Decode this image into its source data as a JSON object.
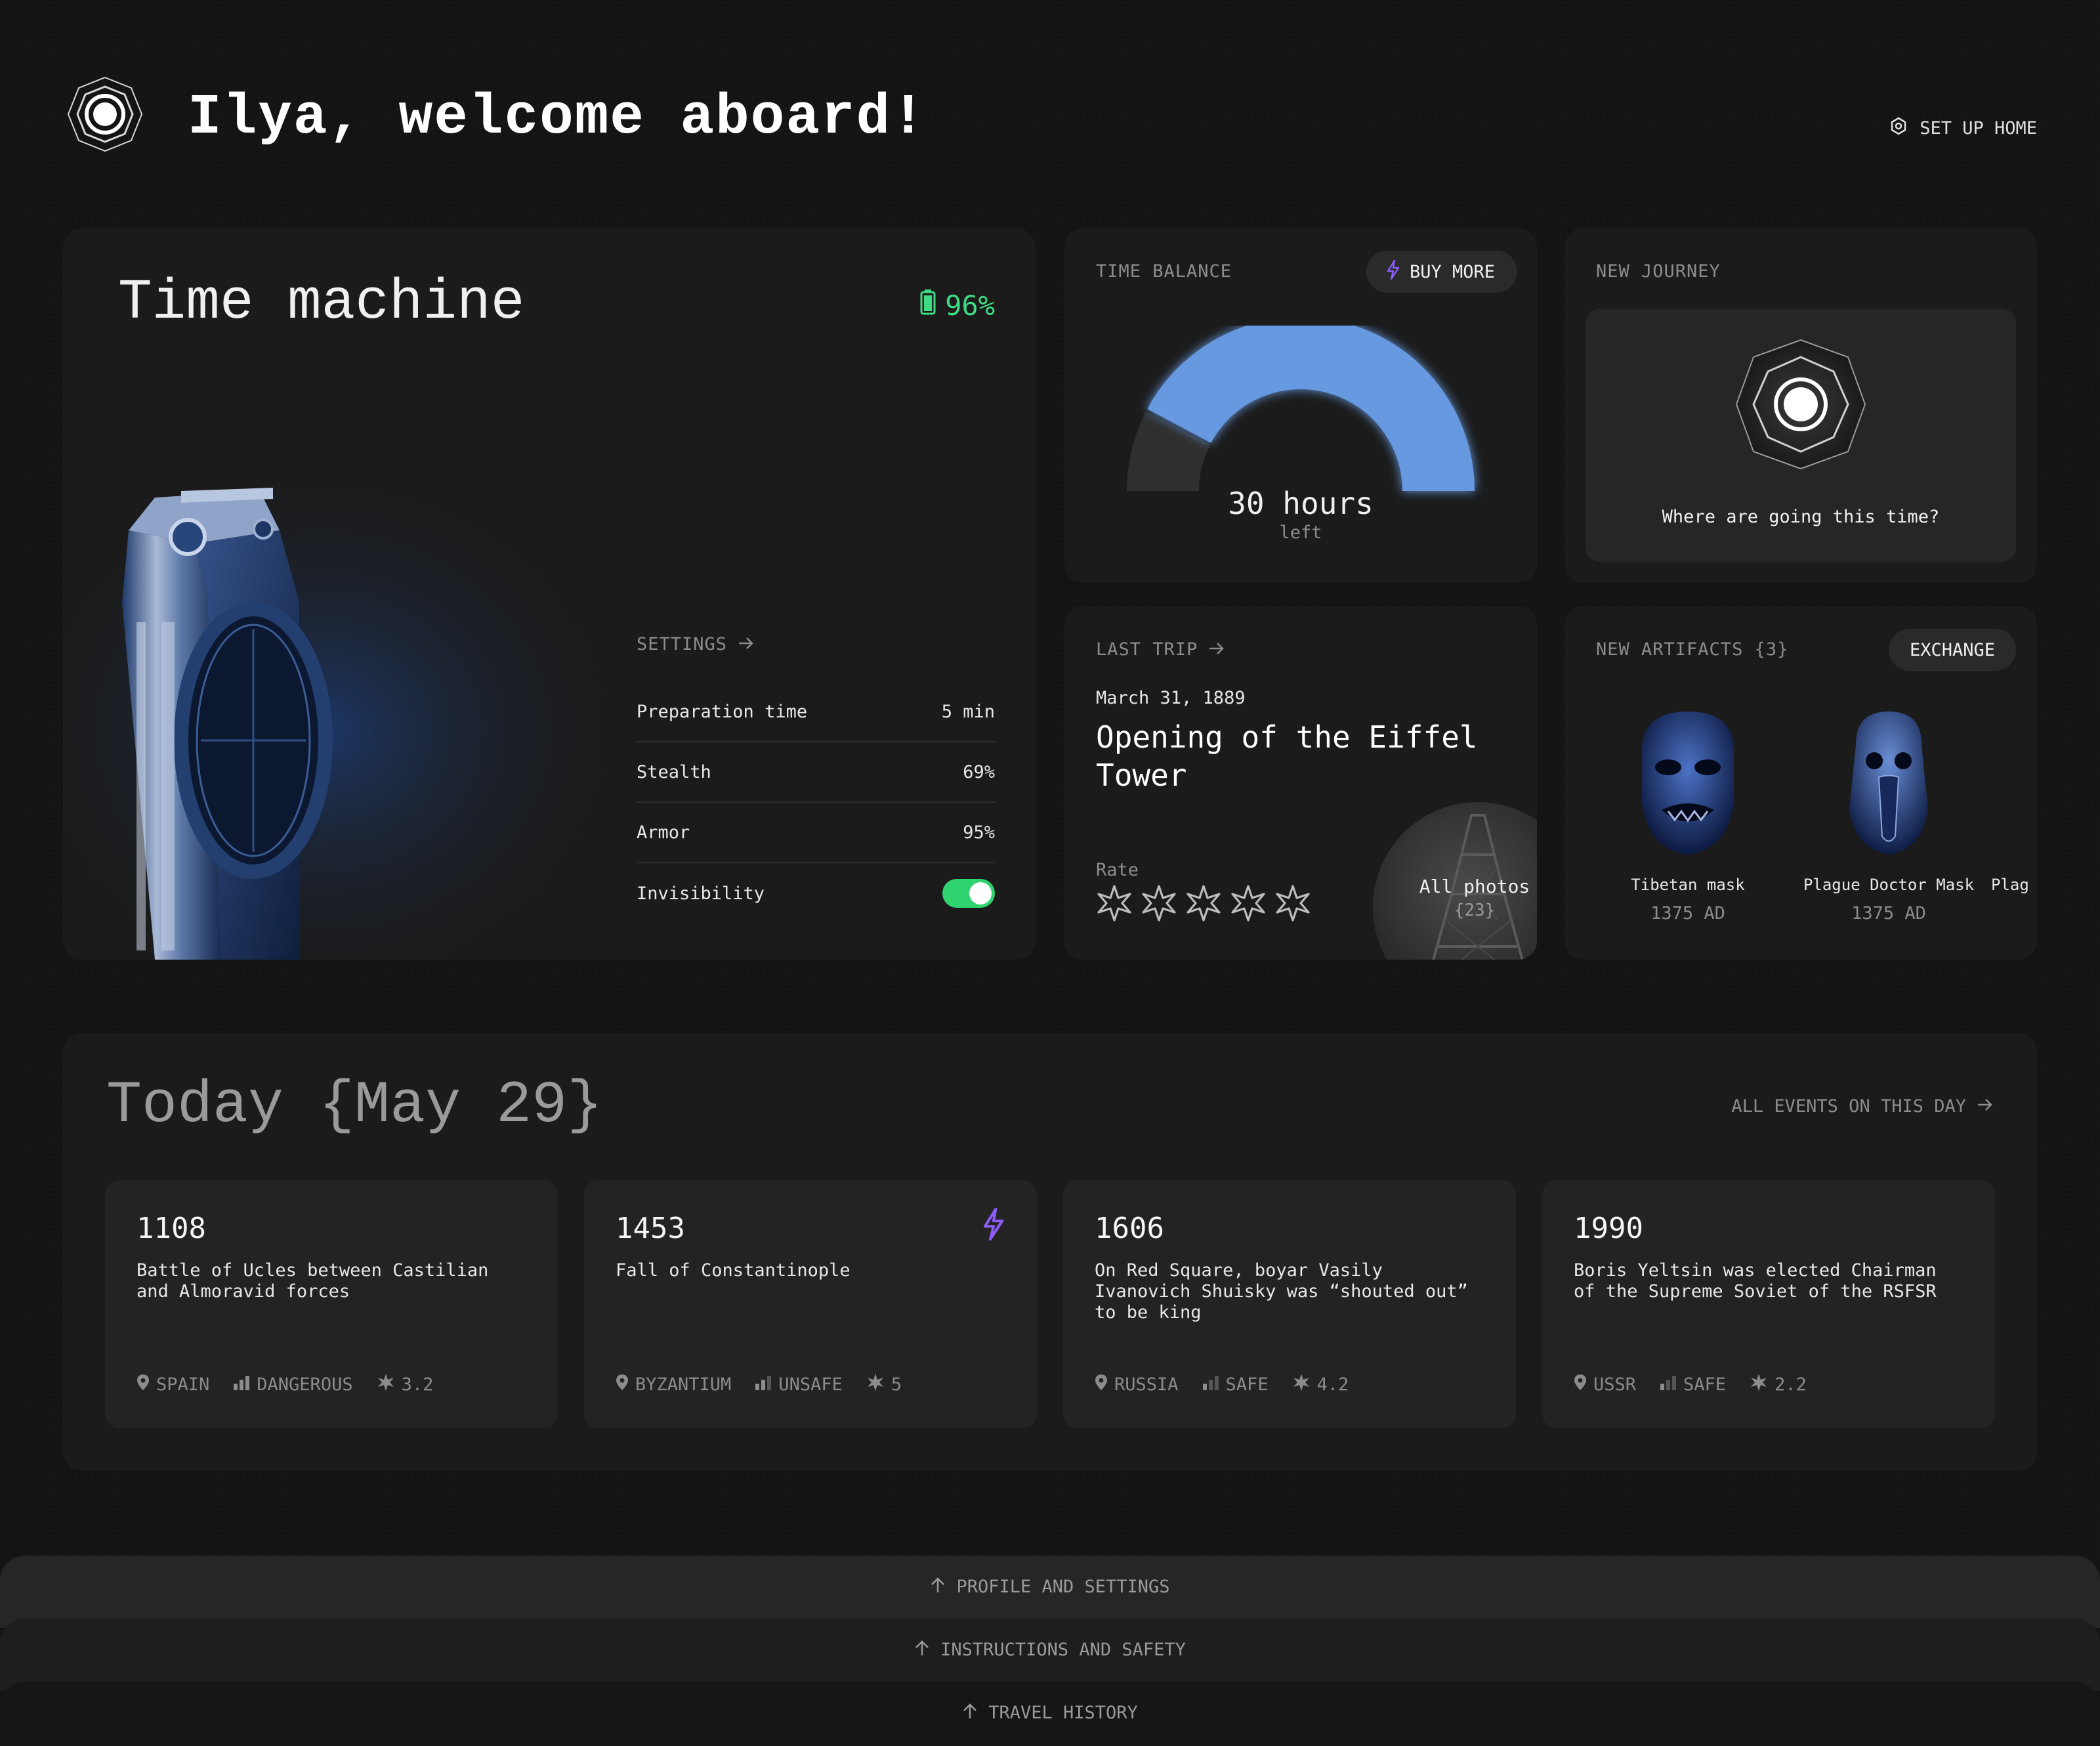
{
  "header": {
    "welcome": "Ilya, welcome aboard!",
    "setup_home": "SET UP HOME"
  },
  "time_machine": {
    "title": "Time machine",
    "battery": "96%",
    "settings_label": "SETTINGS",
    "settings": [
      {
        "label": "Preparation time",
        "value": "5 min"
      },
      {
        "label": "Stealth",
        "value": "69%"
      },
      {
        "label": "Armor",
        "value": "95%"
      },
      {
        "label": "Invisibility",
        "value": ""
      }
    ],
    "invisibility_on": true
  },
  "time_balance": {
    "label": "TIME BALANCE",
    "buy_more": "BUY MORE",
    "hours": "30 hours",
    "left": "left",
    "fill_fraction": 0.85,
    "accent": "#6699e0"
  },
  "new_journey": {
    "label": "NEW JOURNEY",
    "prompt": "Where are going this time?"
  },
  "last_trip": {
    "label": "LAST TRIP",
    "date": "March 31, 1889",
    "title": "Opening of the Eiffel Tower",
    "rate_label": "Rate",
    "rating": 0,
    "all_photos": "All photos",
    "photo_count": "{23}"
  },
  "artifacts": {
    "label": "NEW ARTIFACTS {3}",
    "exchange": "EXCHANGE",
    "items": [
      {
        "name": "Tibetan mask",
        "year": "1375 AD"
      },
      {
        "name": "Plague Doctor Mask",
        "year": "1375 AD"
      },
      {
        "name": "Plag",
        "year": ""
      }
    ]
  },
  "today": {
    "title": "Today {May 29}",
    "all_events": "ALL EVENTS ON THIS DAY",
    "events": [
      {
        "year": "1108",
        "desc": "Battle of Ucles between Castilian and Almoravid forces",
        "place": "SPAIN",
        "danger": "DANGEROUS",
        "rating": "3.2"
      },
      {
        "year": "1453",
        "desc": "Fall of Constantinople",
        "place": "BYZANTIUM",
        "danger": "UNSAFE",
        "rating": "5"
      },
      {
        "year": "1606",
        "desc": "On Red Square, boyar Vasily Ivanovich Shuisky was “shouted out” to be king",
        "place": "RUSSIA",
        "danger": "SAFE",
        "rating": "4.2"
      },
      {
        "year": "1990",
        "desc": "Boris Yeltsin was elected Chairman of the Supreme Soviet of the RSFSR",
        "place": "USSR",
        "danger": "SAFE",
        "rating": "2.2"
      }
    ]
  },
  "drawers": {
    "profile": "PROFILE AND SETTINGS",
    "instructions": "INSTRUCTIONS AND SAFETY",
    "history": "TRAVEL HISTORY"
  },
  "colors": {
    "background": "#141414",
    "card": "#1b1b1b",
    "battery_green": "#3ddc84",
    "bolt_purple": "#8b5cf6"
  }
}
